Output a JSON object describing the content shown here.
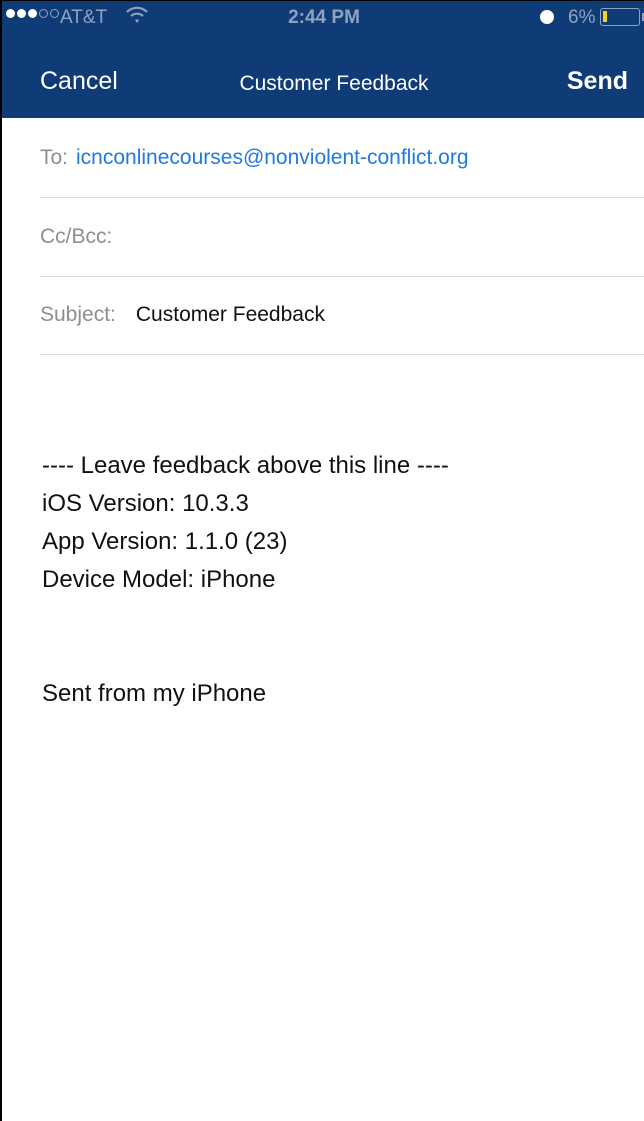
{
  "status_bar": {
    "carrier": "AT&T",
    "time": "2:44 PM",
    "battery_percent": "6%",
    "battery_level": 0.06,
    "signal_bars_filled": 3,
    "signal_bars_total": 5,
    "icons": [
      "signal-dots-icon",
      "wifi-icon",
      "alarm-icon",
      "battery-icon"
    ]
  },
  "nav": {
    "cancel_label": "Cancel",
    "title": "Customer Feedback",
    "send_label": "Send"
  },
  "fields": {
    "to_label": "To:",
    "to_value": "icnconlinecourses@nonviolent-conflict.org",
    "cc_label": "Cc/Bcc:",
    "subject_label": "Subject:",
    "subject_value": "Customer Feedback"
  },
  "body": {
    "separator": "---- Leave feedback above this line ----",
    "ios_version": "iOS Version: 10.3.3",
    "app_version": "App Version: 1.1.0 (23)",
    "device_model": "Device Model: iPhone",
    "signature": "Sent from my iPhone"
  },
  "colors": {
    "header_bg": "#0f3b77",
    "link": "#1f7ae0",
    "label_gray": "#8e8e93",
    "battery_fill": "#f7d21c"
  }
}
